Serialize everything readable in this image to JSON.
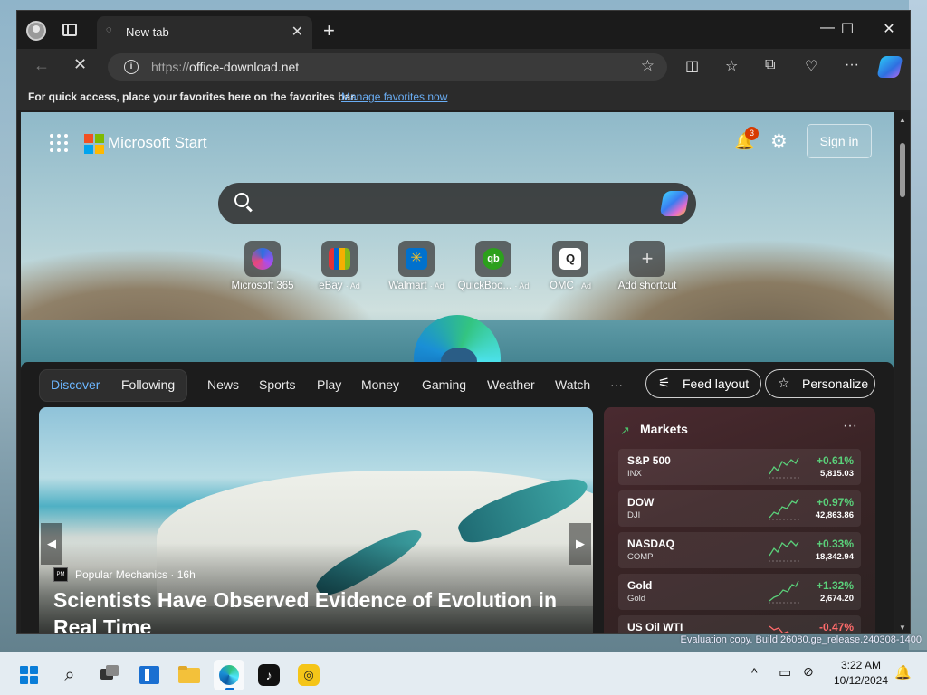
{
  "browser": {
    "tab_title": "New tab",
    "url_protocol": "https://",
    "url_host": "office-download.net",
    "favbar_text": "For quick access, place your favorites here on the favorites bar.",
    "favbar_link": "Manage favorites now"
  },
  "start": {
    "brand": "Microsoft Start",
    "notification_count": "3",
    "signin_label": "Sign in",
    "shortcuts": [
      {
        "label": "Microsoft 365",
        "ad": ""
      },
      {
        "label": "eBay",
        "ad": "· Ad"
      },
      {
        "label": "Walmart",
        "ad": "· Ad"
      },
      {
        "label": "QuickBoo...",
        "ad": "· Ad"
      },
      {
        "label": "OMC",
        "ad": "· Ad"
      },
      {
        "label": "Add shortcut",
        "ad": ""
      }
    ]
  },
  "feed": {
    "tabs": [
      "Discover",
      "Following"
    ],
    "nav": [
      "News",
      "Sports",
      "Play",
      "Money",
      "Gaming",
      "Weather",
      "Watch",
      "···"
    ],
    "feed_layout": "Feed layout",
    "personalize": "Personalize",
    "hero": {
      "source": "Popular Mechanics",
      "age": "· 16h",
      "headline": "Scientists Have Observed Evidence of Evolution in Real Time"
    },
    "markets": {
      "title": "Markets",
      "rows": [
        {
          "name": "S&P 500",
          "symbol": "INX",
          "change": "+0.61%",
          "value": "5,815.03",
          "color": "#5ad07a"
        },
        {
          "name": "DOW",
          "symbol": "DJI",
          "change": "+0.97%",
          "value": "42,863.86",
          "color": "#5ad07a"
        },
        {
          "name": "NASDAQ",
          "symbol": "COMP",
          "change": "+0.33%",
          "value": "18,342.94",
          "color": "#5ad07a"
        },
        {
          "name": "Gold",
          "symbol": "Gold",
          "change": "+1.32%",
          "value": "2,674.20",
          "color": "#5ad07a"
        },
        {
          "name": "US Oil WTI",
          "symbol": "",
          "change": "-0.47%",
          "value": "",
          "color": "#ff6b6b"
        }
      ]
    }
  },
  "desktop": {
    "watermark": "Evaluation copy. Build 26080.ge_release.240308-1400"
  },
  "taskbar": {
    "time": "3:22 AM",
    "date": "10/12/2024"
  }
}
